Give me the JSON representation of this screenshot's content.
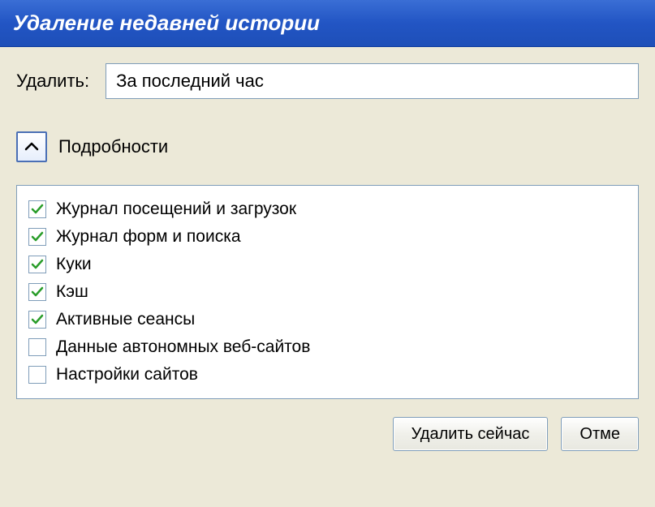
{
  "titlebar": {
    "title": "Удаление недавней истории"
  },
  "range": {
    "label": "Удалить:",
    "selected": "За последний час"
  },
  "details": {
    "label": "Подробности"
  },
  "items": [
    {
      "label": "Журнал посещений и загрузок",
      "checked": true
    },
    {
      "label": "Журнал форм и поиска",
      "checked": true
    },
    {
      "label": "Куки",
      "checked": true
    },
    {
      "label": "Кэш",
      "checked": true
    },
    {
      "label": "Активные сеансы",
      "checked": true
    },
    {
      "label": "Данные автономных веб-сайтов",
      "checked": false
    },
    {
      "label": "Настройки сайтов",
      "checked": false
    }
  ],
  "buttons": {
    "clear": "Удалить сейчас",
    "cancel": "Отме"
  }
}
